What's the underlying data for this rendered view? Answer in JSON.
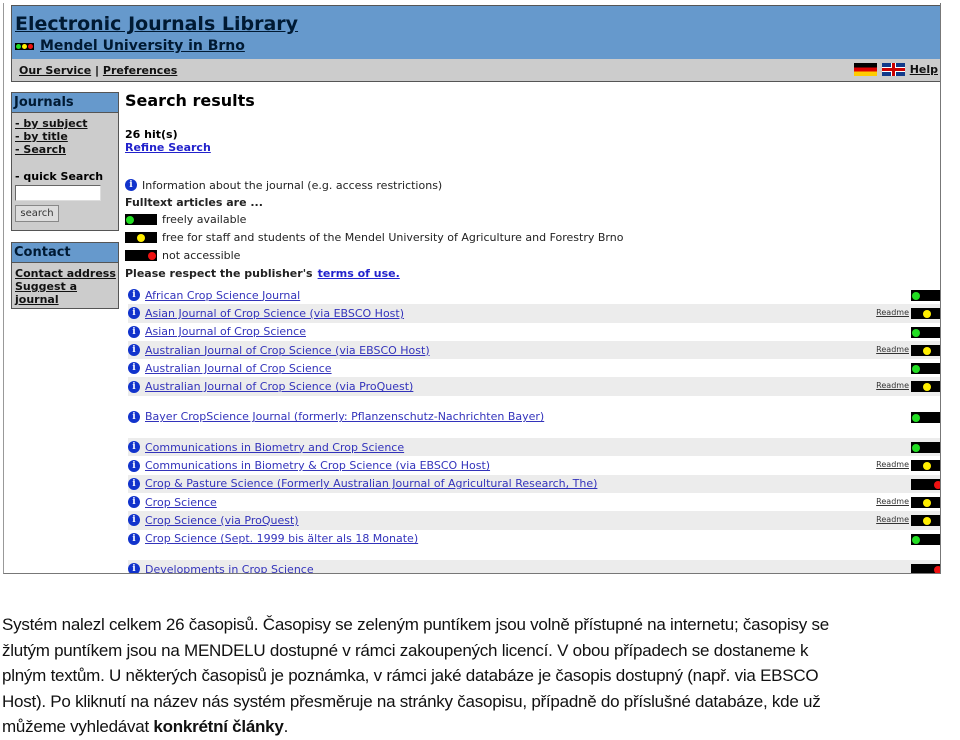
{
  "header": {
    "title": "Electronic Journals Library",
    "institution": "Mendel University in Brno"
  },
  "nav": {
    "our_service": "Our Service",
    "separator": "|",
    "preferences": "Preferences",
    "help": "Help",
    "flags": [
      "german-flag",
      "uk-flag"
    ]
  },
  "sidebar": {
    "journals_title": "Journals",
    "links": [
      "- by subject",
      "- by title",
      "- Search"
    ],
    "quick_search_label": "- quick Search",
    "quick_search_value": "",
    "search_button": "search",
    "contact_title": "Contact",
    "contact_links": [
      "Contact address",
      "Suggest a journal"
    ]
  },
  "main": {
    "title": "Search results",
    "hits": "26 hit(s)",
    "refine": "Refine Search",
    "info_text": "Information about the journal (e.g. access restrictions)",
    "fulltext_label": "Fulltext articles are ...",
    "legend": [
      {
        "status": "green",
        "label": "freely available"
      },
      {
        "status": "yellow",
        "label": "free for staff and students of the Mendel University of Agriculture and Forestry Brno"
      },
      {
        "status": "red",
        "label": "not accessible"
      }
    ],
    "respect_text": "Please respect the publisher's",
    "terms_link": "terms of use."
  },
  "colors": {
    "green": "#22dd22",
    "yellow": "#ffee00",
    "red": "#ee1111",
    "header_blue": "#6699cc",
    "link": "#3333bb"
  },
  "results": [
    {
      "title": "African Crop Science Journal",
      "status": "green",
      "readme": ""
    },
    {
      "title": "Asian Journal of Crop Science (via EBSCO Host)",
      "status": "yellow",
      "readme": "Readme"
    },
    {
      "title": "Asian Journal of Crop Science",
      "status": "green",
      "readme": ""
    },
    {
      "title": "Australian Journal of Crop Science (via EBSCO Host)",
      "status": "yellow",
      "readme": "Readme"
    },
    {
      "title": "Australian Journal of Crop Science",
      "status": "green",
      "readme": ""
    },
    {
      "title": "Australian Journal of Crop Science (via ProQuest)",
      "status": "yellow",
      "readme": "Readme"
    },
    {
      "title": "Bayer CropScience Journal (formerly: Pflanzenschutz-Nachrichten Bayer)",
      "status": "green",
      "readme": ""
    },
    {
      "title": "Communications in Biometry and Crop Science",
      "status": "green",
      "readme": ""
    },
    {
      "title": "Communications in Biometry & Crop Science (via EBSCO Host)",
      "status": "yellow",
      "readme": "Readme"
    },
    {
      "title": "Crop & Pasture Science (Formerly Australian Journal of Agricultural Research, The)",
      "status": "red",
      "readme": ""
    },
    {
      "title": "Crop Science",
      "status": "yellow",
      "readme": "Readme"
    },
    {
      "title": "Crop Science (via ProQuest)",
      "status": "yellow",
      "readme": "Readme"
    },
    {
      "title": "Crop Science (Sept. 1999 bis älter als 18 Monate)",
      "status": "green",
      "readme": ""
    },
    {
      "title": "Developments in Crop Science",
      "status": "red",
      "readme": ""
    }
  ],
  "caption": {
    "lines": [
      "Systém nalezl celkem 26 časopisů. Časopisy se zeleným puntíkem jsou volně přístupné na internetu; časopisy se",
      "žlutým puntíkem jsou na MENDELU dostupné v rámci zakoupených licencí. V obou případech se dostaneme k",
      "plným textům. U některých časopisů je poznámka, v rámci jaké databáze je časopis dostupný (např. via EBSCO",
      "Host). Po kliknutí na název nás systém přesměruje na stránky časopisu, případně do příslušné databáze, kde už"
    ],
    "last_line_start": "můžeme vyhledávat ",
    "last_line_bold": "konkrétní články",
    "last_line_end": "."
  }
}
